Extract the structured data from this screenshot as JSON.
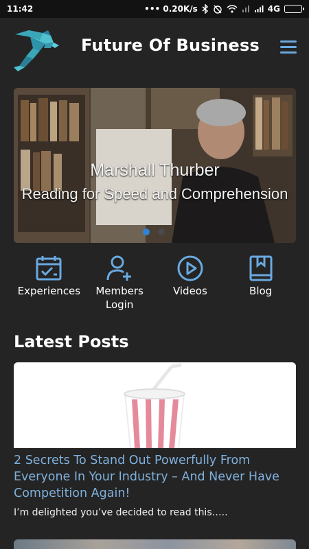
{
  "status_bar": {
    "time": "11:42",
    "speed": "••• 0.20K/s",
    "network": "4G"
  },
  "header": {
    "title": "Future Of Business",
    "logo_icon": "dolphin-logo-icon",
    "menu_icon": "hamburger-menu-icon"
  },
  "hero": {
    "line1": "Marshall Thurber",
    "line2": "Reading for Speed and Comprehension",
    "slide_index": 1,
    "slide_count": 2
  },
  "nav": {
    "items": [
      {
        "label": "Experiences",
        "icon": "calendar-check-icon"
      },
      {
        "label": "Members\nLogin",
        "icon": "user-add-icon"
      },
      {
        "label": "Videos",
        "icon": "play-circle-icon"
      },
      {
        "label": "Blog",
        "icon": "book-icon"
      }
    ]
  },
  "latest": {
    "title": "Latest Posts",
    "posts": [
      {
        "title": "2 Secrets To Stand Out Powerfully From Everyone In Your Industry – And Never Have Competition Again!",
        "excerpt": "I’m delighted you’ve decided to read this….."
      }
    ]
  },
  "colors": {
    "background": "#242424",
    "accent": "#6aa9e0",
    "link": "#7fb0dc",
    "active_dot": "#2f83d3"
  }
}
